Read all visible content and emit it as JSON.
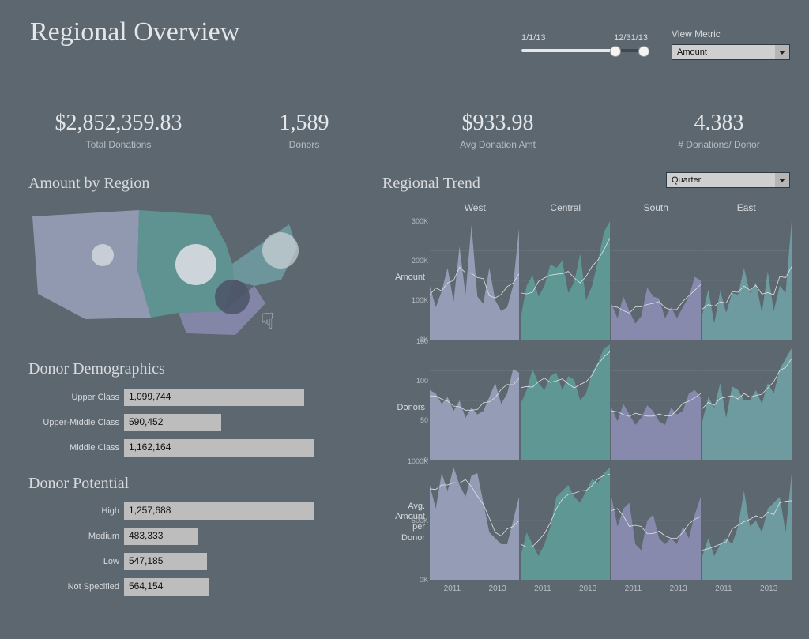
{
  "page": {
    "title": "Regional Overview"
  },
  "controls": {
    "date_range": {
      "start": "1/1/13",
      "end": "12/31/13"
    },
    "metric_label": "View Metric",
    "metric_value": "Amount",
    "grain_value": "Quarter"
  },
  "kpis": {
    "total": {
      "value": "$2,852,359.83",
      "label": "Total Donations"
    },
    "donors": {
      "value": "1,589",
      "label": "Donors"
    },
    "avg": {
      "value": "$933.98",
      "label": "Avg Donation Amt"
    },
    "per": {
      "value": "4.383",
      "label": "# Donations/ Donor"
    }
  },
  "sections": {
    "region": "Amount by Region",
    "demo": "Donor Demographics",
    "pot": "Donor Potential",
    "trend": "Regional Trend"
  },
  "map": {
    "regions": [
      "West",
      "Central",
      "South",
      "East"
    ],
    "colors": {
      "West": "#9aa2bc",
      "Central": "#5e9b97",
      "South": "#8b8cb2",
      "East": "#6f9fa3"
    }
  },
  "demo": {
    "max": 1200000,
    "rows": [
      {
        "label": "Upper Class",
        "value": 1099744,
        "text": "1,099,744"
      },
      {
        "label": "Upper-Middle Class",
        "value": 590452,
        "text": "590,452"
      },
      {
        "label": "Middle Class",
        "value": 1162164,
        "text": "1,162,164"
      }
    ]
  },
  "pot": {
    "max": 1300000,
    "rows": [
      {
        "label": "High",
        "value": 1257688,
        "text": "1,257,688"
      },
      {
        "label": "Medium",
        "value": 483333,
        "text": "483,333"
      },
      {
        "label": "Low",
        "value": 547185,
        "text": "547,185"
      },
      {
        "label": "Not Specified",
        "value": 564154,
        "text": "564,154"
      }
    ]
  },
  "trend": {
    "columns": [
      "West",
      "Central",
      "South",
      "East"
    ],
    "xticks": [
      "2011",
      "2013"
    ],
    "rows": {
      "amount": {
        "label": "Amount",
        "yticks": [
          "300K",
          "200K",
          "100K",
          "0K"
        ],
        "ylim": [
          0,
          330000
        ]
      },
      "donors": {
        "label": "Donors",
        "yticks": [
          "150",
          "100",
          "50",
          "0"
        ],
        "ylim": [
          0,
          170
        ]
      },
      "avgamt": {
        "label": "Avg.\nAmount\nper\nDonor",
        "yticks": [
          "1000K",
          "500K",
          "0K"
        ],
        "ylim": [
          0,
          1000000
        ]
      }
    }
  },
  "chart_data": [
    {
      "type": "bar",
      "title": "Donor Demographics",
      "xlabel": "",
      "ylabel": "Amount",
      "categories": [
        "Upper Class",
        "Upper-Middle Class",
        "Middle Class"
      ],
      "values": [
        1099744,
        590452,
        1162164
      ],
      "ylim": [
        0,
        1200000
      ]
    },
    {
      "type": "bar",
      "title": "Donor Potential",
      "xlabel": "",
      "ylabel": "Amount",
      "categories": [
        "High",
        "Medium",
        "Low",
        "Not Specified"
      ],
      "values": [
        1257688,
        483333,
        547185,
        564154
      ],
      "ylim": [
        0,
        1300000
      ]
    },
    {
      "type": "area",
      "title": "Regional Trend — Amount",
      "ylabel": "Amount",
      "xlabel": "Quarter",
      "ylim": [
        0,
        330000
      ],
      "x": [
        "2010Q1",
        "2010Q2",
        "2010Q3",
        "2010Q4",
        "2011Q1",
        "2011Q2",
        "2011Q3",
        "2011Q4",
        "2012Q1",
        "2012Q2",
        "2012Q3",
        "2012Q4",
        "2013Q1",
        "2013Q2",
        "2013Q3",
        "2013Q4"
      ],
      "series": [
        {
          "name": "West",
          "values": [
            150000,
            90000,
            135000,
            200000,
            105000,
            260000,
            125000,
            320000,
            120000,
            100000,
            200000,
            110000,
            80000,
            90000,
            150000,
            310000
          ]
        },
        {
          "name": "Central",
          "values": [
            60000,
            150000,
            180000,
            120000,
            150000,
            210000,
            200000,
            220000,
            130000,
            160000,
            240000,
            110000,
            150000,
            220000,
            300000,
            330000
          ]
        },
        {
          "name": "South",
          "values": [
            100000,
            60000,
            120000,
            80000,
            45000,
            65000,
            145000,
            120000,
            115000,
            60000,
            90000,
            60000,
            90000,
            120000,
            175000,
            165000
          ]
        },
        {
          "name": "East",
          "values": [
            70000,
            140000,
            45000,
            136000,
            75000,
            130000,
            125000,
            200000,
            130000,
            160000,
            75000,
            190000,
            80000,
            150000,
            130000,
            330000
          ]
        }
      ]
    },
    {
      "type": "area",
      "title": "Regional Trend — Donors",
      "ylabel": "Donors",
      "xlabel": "Quarter",
      "ylim": [
        0,
        170
      ],
      "x": [
        "2010Q1",
        "2010Q2",
        "2010Q3",
        "2010Q4",
        "2011Q1",
        "2011Q2",
        "2011Q3",
        "2011Q4",
        "2012Q1",
        "2012Q2",
        "2012Q3",
        "2012Q4",
        "2013Q1",
        "2013Q2",
        "2013Q3",
        "2013Q4"
      ],
      "series": [
        {
          "name": "West",
          "values": [
            100,
            95,
            80,
            90,
            70,
            85,
            60,
            75,
            65,
            70,
            90,
            110,
            80,
            95,
            130,
            125
          ]
        },
        {
          "name": "Central",
          "values": [
            80,
            100,
            130,
            110,
            100,
            120,
            125,
            100,
            120,
            115,
            85,
            95,
            125,
            140,
            160,
            165
          ]
        },
        {
          "name": "South",
          "values": [
            75,
            55,
            80,
            65,
            50,
            60,
            78,
            70,
            55,
            50,
            75,
            65,
            70,
            95,
            100,
            90
          ]
        },
        {
          "name": "East",
          "values": [
            55,
            90,
            75,
            110,
            60,
            105,
            100,
            85,
            85,
            100,
            80,
            110,
            95,
            130,
            145,
            160
          ]
        }
      ]
    },
    {
      "type": "area",
      "title": "Regional Trend — Avg Amount per Donor",
      "ylabel": "Avg Amount/Donor",
      "xlabel": "Quarter",
      "ylim": [
        0,
        1000000
      ],
      "x": [
        "2010Q1",
        "2010Q2",
        "2010Q3",
        "2010Q4",
        "2011Q1",
        "2011Q2",
        "2011Q3",
        "2011Q4",
        "2012Q1",
        "2012Q2",
        "2012Q3",
        "2012Q4",
        "2013Q1",
        "2013Q2",
        "2013Q3",
        "2013Q4"
      ],
      "series": [
        {
          "name": "West",
          "values": [
            800000,
            600000,
            900000,
            750000,
            950000,
            800000,
            700000,
            880000,
            900000,
            650000,
            400000,
            350000,
            300000,
            300000,
            500000,
            700000
          ]
        },
        {
          "name": "Central",
          "values": [
            200000,
            400000,
            300000,
            200000,
            300000,
            450000,
            700000,
            750000,
            800000,
            700000,
            650000,
            750000,
            850000,
            820000,
            900000,
            950000
          ]
        },
        {
          "name": "South",
          "values": [
            700000,
            450000,
            600000,
            650000,
            300000,
            250000,
            500000,
            550000,
            350000,
            300000,
            350000,
            300000,
            450000,
            350000,
            550000,
            700000
          ]
        },
        {
          "name": "East",
          "values": [
            200000,
            350000,
            200000,
            300000,
            350000,
            300000,
            450000,
            750000,
            450000,
            500000,
            400000,
            600000,
            650000,
            700000,
            400000,
            900000
          ]
        }
      ]
    }
  ]
}
